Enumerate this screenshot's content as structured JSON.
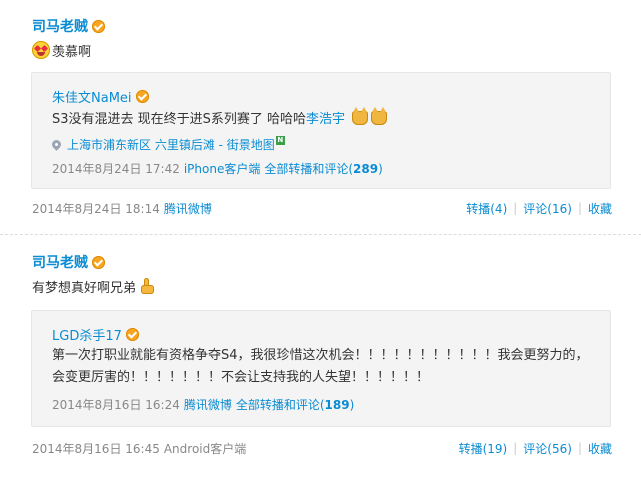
{
  "posts": [
    {
      "author": "司马老贼",
      "text": "羡慕啊",
      "emoji_icon": "envy-face-icon",
      "repost": {
        "author": "朱佳文NaMei",
        "text_before": "S3没有混进去 现在终于进S系列赛了 哈哈哈",
        "mention": "李浩宇",
        "location": "上海市浦东新区 六里镇后滩 - 街景地图",
        "map_badge": "N",
        "time": "2014年8月24日 17:42",
        "source": "iPhone客户端",
        "all_label": "全部转播和评论(",
        "all_count": "289",
        "all_close": ")"
      },
      "footer": {
        "time": "2014年8月24日 18:14",
        "source": "腾讯微博",
        "repost": "转播(4)",
        "comment": "评论(16)",
        "favorite": "收藏"
      }
    },
    {
      "author": "司马老贼",
      "text": "有梦想真好啊兄弟",
      "emoji_icon": "thumbs-up-icon",
      "repost": {
        "author": "LGD杀手17",
        "text": "第一次打职业就能有资格争夺S4，我很珍惜这次机会！！！！！！！！！！！我会更努力的，会变更厉害的！！！！！！！不会让支持我的人失望！！！！！！",
        "time": "2014年8月16日 16:24",
        "source": "腾讯微博",
        "all_label": "全部转播和评论(",
        "all_count": "189",
        "all_close": ")"
      },
      "footer": {
        "time": "2014年8月16日 16:45",
        "source": "Android客户端",
        "repost": "转播(19)",
        "comment": "评论(56)",
        "favorite": "收藏"
      }
    }
  ],
  "colors": {
    "link": "#0a8cd2",
    "meta": "#888888",
    "box_bg": "#f4f4f4",
    "verify": "#f6a623"
  }
}
